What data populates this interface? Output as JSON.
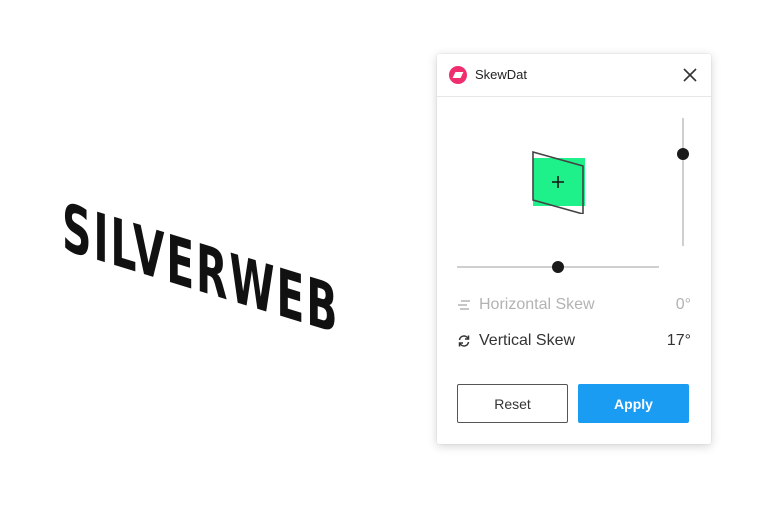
{
  "artwork": {
    "text": "SILVERWEB"
  },
  "panel": {
    "title": "SkewDat",
    "logo_icon": "skewdat-logo-icon",
    "close_icon": "close-icon",
    "preview_fill_color": "#1ef08a",
    "preview_icon": "plus-icon"
  },
  "sliders": {
    "horizontal_level": 0.5,
    "vertical_level": 0.28
  },
  "skews": {
    "horizontal": {
      "label": "Horizontal Skew",
      "value": "0°",
      "icon": "horizontal-skew-icon",
      "state": "disabled"
    },
    "vertical": {
      "label": "Vertical Skew",
      "value": "17°",
      "icon": "refresh-icon",
      "state": "active"
    }
  },
  "buttons": {
    "reset_label": "Reset",
    "apply_label": "Apply"
  },
  "colors": {
    "accent": "#1a9cf2",
    "brand": "#f02d6f",
    "preview_green": "#1ef08a"
  }
}
